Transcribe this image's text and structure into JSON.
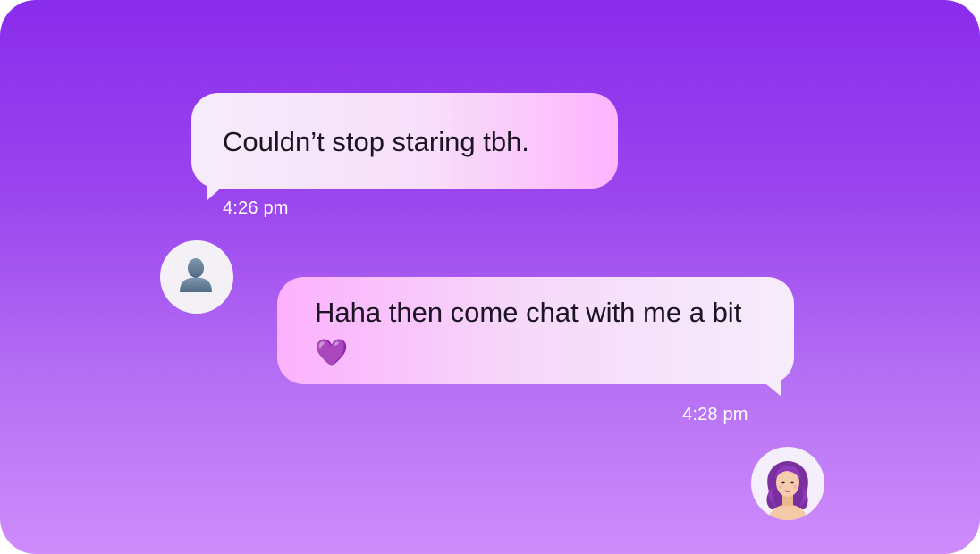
{
  "messages": [
    {
      "direction": "incoming",
      "text": "Couldn’t stop staring tbh.",
      "time": "4:26 pm",
      "avatar_icon": "default-person-icon"
    },
    {
      "direction": "outgoing",
      "text": "Haha then come chat with me a bit",
      "emoji": "💜",
      "time": "4:28 pm",
      "avatar_icon": "woman-avatar-icon"
    }
  ],
  "colors": {
    "background_top": "#8a2cec",
    "background_bottom": "#cf8cfb",
    "bubble_light": "#f6ecfb",
    "bubble_pink": "#feb4fe",
    "text": "#1c1424",
    "timestamp": "#ffffff"
  }
}
